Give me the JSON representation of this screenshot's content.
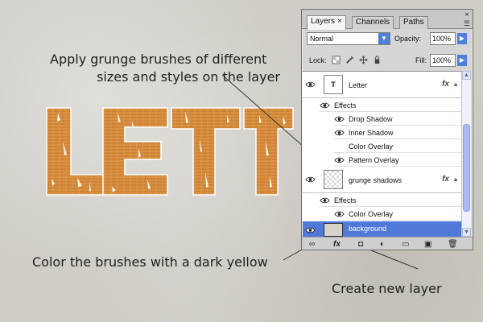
{
  "annotations": {
    "line1": "Apply grunge brushes of different",
    "line2": "sizes and styles on the layer",
    "line3": "Color the brushes with a dark yellow",
    "line4": "Create new layer"
  },
  "artwork": {
    "text": "LETT"
  },
  "layers_panel": {
    "tabs": [
      {
        "label": "Layers",
        "active": true
      },
      {
        "label": "Channels",
        "active": false
      },
      {
        "label": "Paths",
        "active": false
      }
    ],
    "blend_mode": "Normal",
    "opacity_label": "Opacity:",
    "opacity_value": "100%",
    "lock_label": "Lock:",
    "fill_label": "Fill:",
    "fill_value": "100%",
    "layers": [
      {
        "name": "Letter",
        "thumb_text": "T",
        "fx": "fx",
        "effects_label": "Effects",
        "effects": [
          "Drop Shadow",
          "Inner Shadow",
          "Color Overlay",
          "Pattern Overlay"
        ]
      },
      {
        "name": "grunge shadows",
        "fx": "fx",
        "effects_label": "Effects",
        "effects": [
          "Color Overlay"
        ]
      },
      {
        "name": "background",
        "selected": true
      }
    ],
    "bottom_tools": [
      "link-layers",
      "fx",
      "mask",
      "adjustment",
      "group",
      "new-layer",
      "delete"
    ]
  },
  "colors": {
    "letter_fill": "#d99342",
    "selection_blue": "#4f78d8"
  }
}
